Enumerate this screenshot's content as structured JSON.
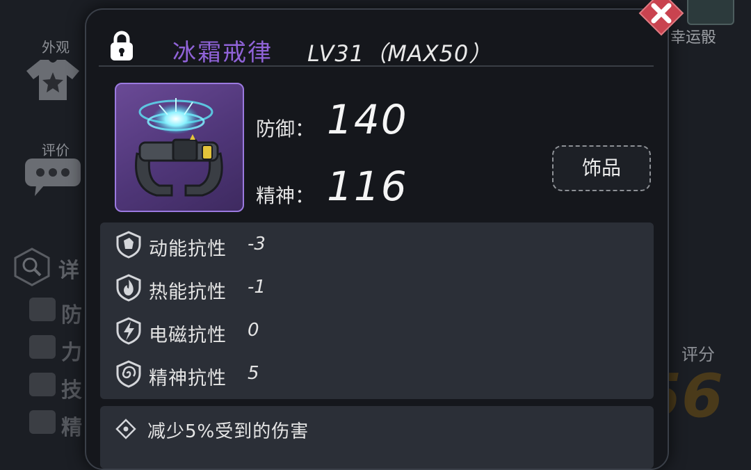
{
  "background": {
    "left_tabs": [
      {
        "label": "外观",
        "icon": "shirt-star-icon"
      },
      {
        "label": "评价",
        "icon": "chat-bubble-icon"
      }
    ],
    "details_partial": "详",
    "stat_partials": [
      "防",
      "力",
      "技",
      "精"
    ],
    "lucky_dice": {
      "label": "幸运骰",
      "icon": "dice-icon"
    },
    "score": {
      "label": "评分",
      "value_partial": "56"
    }
  },
  "dialog": {
    "lock_icon": "lock-icon",
    "item_name": "冰霜戒律",
    "item_level": "LV31（MAX50）",
    "item_image": "frost-bracelet-icon",
    "stats": [
      {
        "label": "防御：",
        "value": "140"
      },
      {
        "label": "精神：",
        "value": "116"
      }
    ],
    "type_badge": "饰品",
    "resistances": [
      {
        "icon": "kinetic-resist-icon",
        "label": "动能抗性",
        "value": "-3"
      },
      {
        "icon": "thermal-resist-icon",
        "label": "热能抗性",
        "value": "-1"
      },
      {
        "icon": "electromagnetic-resist-icon",
        "label": "电磁抗性",
        "value": "0"
      },
      {
        "icon": "mental-resist-icon",
        "label": "精神抗性",
        "value": "5"
      }
    ],
    "effect": {
      "icon": "diamond-effect-icon",
      "text": "减少5%受到的伤害"
    },
    "close_icon": "close-icon"
  },
  "colors": {
    "item_name": "#9063d8",
    "panel": "#2b2f37",
    "dialog_bg": "#15171c",
    "close_button": "#c9434f"
  }
}
